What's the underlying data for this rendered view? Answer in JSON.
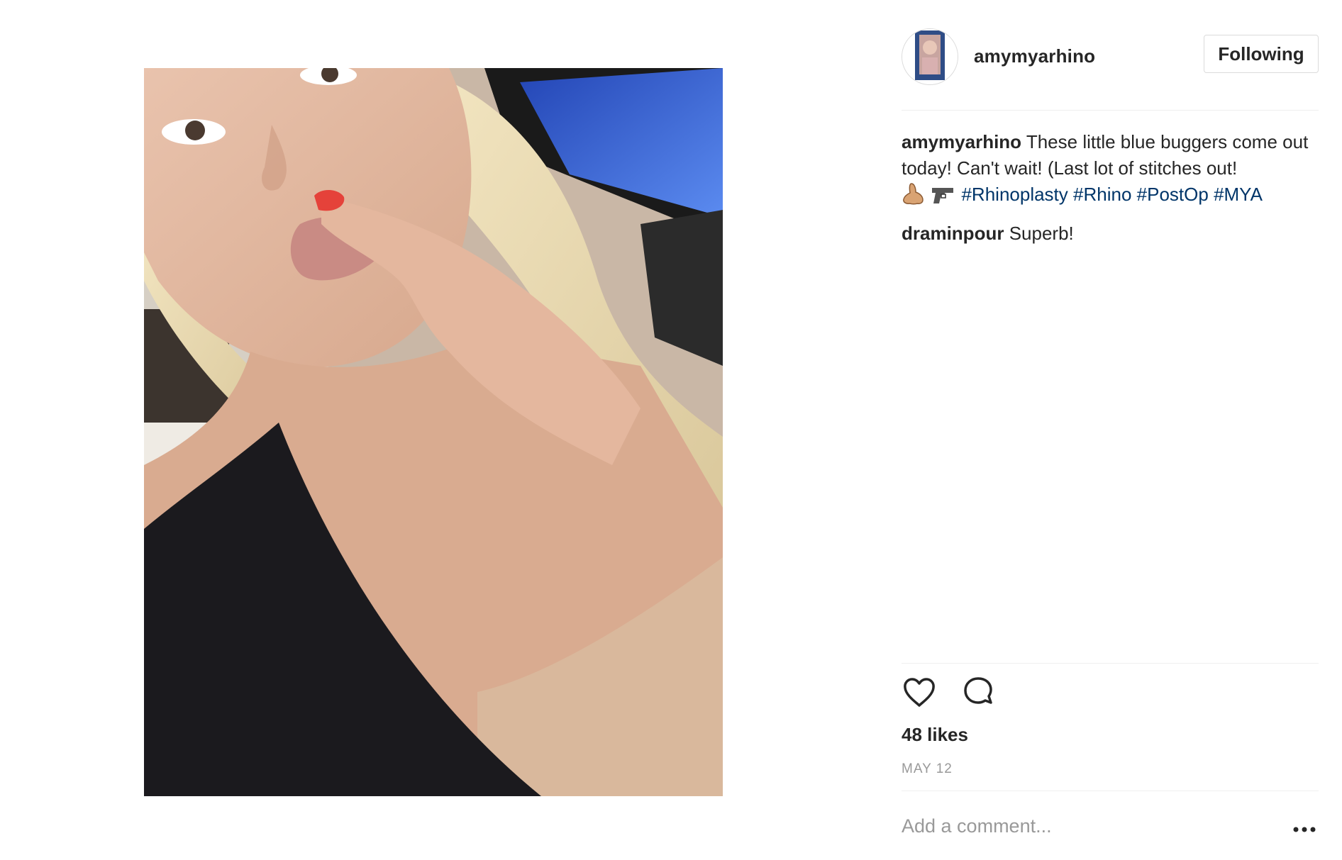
{
  "post": {
    "photo_icon": "selfie-photo",
    "author": {
      "username": "amymyarhino",
      "avatar_icon": "profile-avatar",
      "follow_button_label": "Following"
    },
    "caption": {
      "username": "amymyarhino",
      "text": "These little blue buggers come out today! Can't wait! (Last lot of stitches out!",
      "emojis": [
        "nose-emoji",
        "pistol-emoji"
      ],
      "hashtags": [
        "#Rhinoplasty",
        "#Rhino",
        "#PostOp",
        "#MYA"
      ]
    },
    "comments": [
      {
        "username": "draminpour",
        "text": "Superb!"
      }
    ],
    "actions": {
      "like_icon": "heart-icon",
      "comment_icon": "comment-bubble-icon"
    },
    "likes_text": "48 likes",
    "date_text": "MAY 12",
    "add_comment_placeholder": "Add a comment...",
    "more_icon": "more-options-icon"
  },
  "colors": {
    "text": "#262626",
    "hashtag": "#003569",
    "muted": "#999999",
    "divider": "#efefef",
    "button_border": "#dbdbdb"
  }
}
